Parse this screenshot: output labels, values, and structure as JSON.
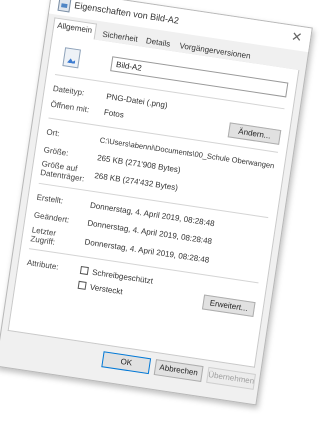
{
  "window": {
    "title": "Eigenschaften von Bild-A2",
    "close_icon": "close-icon"
  },
  "tabs": [
    {
      "label": "Allgemein",
      "active": true
    },
    {
      "label": "Sicherheit"
    },
    {
      "label": "Details"
    },
    {
      "label": "Vorgängerversionen"
    }
  ],
  "general": {
    "file_name": "Bild-A2",
    "type_label": "Dateityp:",
    "type_value": "PNG-Datei (.png)",
    "opens_with_label": "Öffnen mit:",
    "opens_with_value": "Fotos",
    "change_button": "Ändern...",
    "location_label": "Ort:",
    "location_value": "C:\\Users\\abenni\\Documents\\00_Schule Oberwangen",
    "size_label": "Größe:",
    "size_value": "265 KB (271'908 Bytes)",
    "size_on_disk_label": "Größe auf Datenträger:",
    "size_on_disk_value": "268 KB (274'432 Bytes)",
    "created_label": "Erstellt:",
    "created_value": "Donnerstag, 4. April 2019, 08:28:48",
    "modified_label": "Geändert:",
    "modified_value": "Donnerstag, 4. April 2019, 08:28:48",
    "accessed_label": "Letzter Zugriff:",
    "accessed_value": "Donnerstag, 4. April 2019, 08:28:48",
    "attributes_label": "Attribute:",
    "readonly_label": "Schreibgeschützt",
    "readonly_checked": false,
    "hidden_label": "Versteckt",
    "hidden_checked": false,
    "advanced_button": "Erweitert..."
  },
  "footer": {
    "ok": "OK",
    "cancel": "Abbrechen",
    "apply": "Übernehmen"
  },
  "colors": {
    "accent": "#0078d7",
    "dialog_bg": "#f0f0f0"
  }
}
